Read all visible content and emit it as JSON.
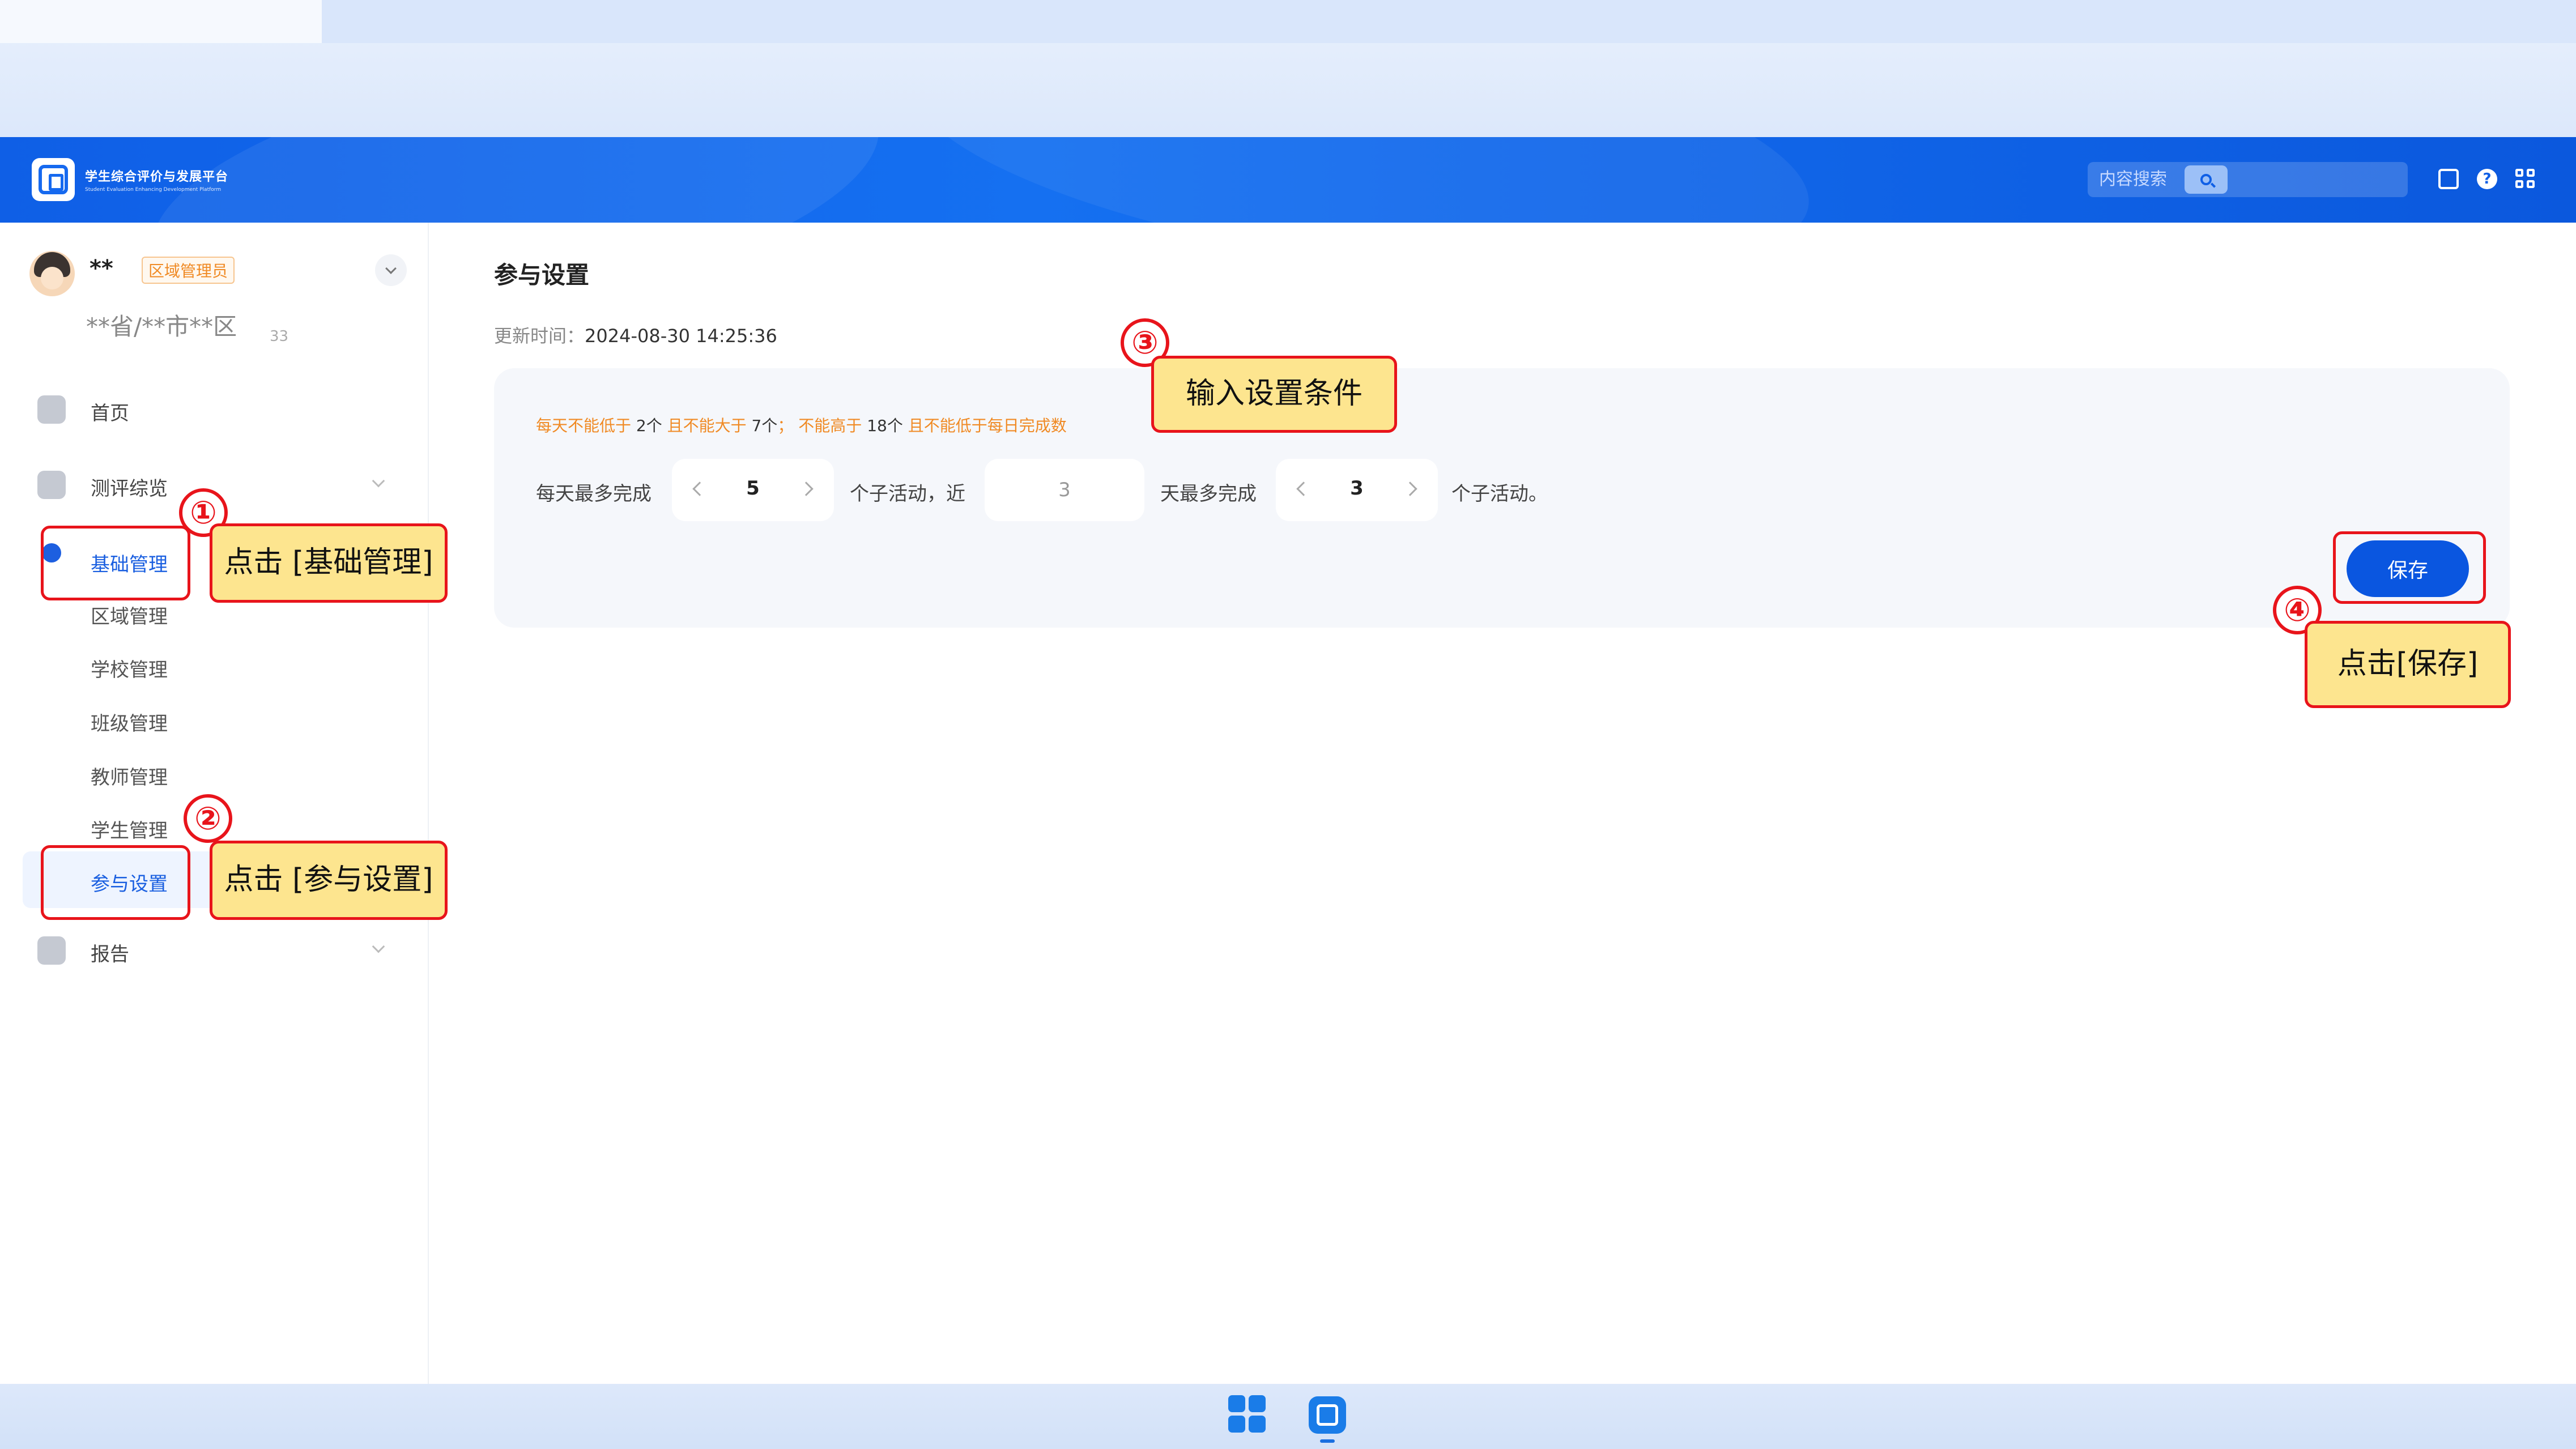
{
  "header": {
    "brand_cn": "学生综合评价与发展平台",
    "brand_en": "Student Evaluation Enhancing Development Platform",
    "search_placeholder": "内容搜索"
  },
  "user": {
    "name": "**",
    "role": "区域管理员",
    "region": "**省/**市**区",
    "version": "33"
  },
  "sidebar": {
    "items": [
      {
        "label": "首页"
      },
      {
        "label": "测评综览"
      },
      {
        "label": "基础管理"
      },
      {
        "label": "报告"
      }
    ],
    "sub_items": [
      {
        "label": "区域管理"
      },
      {
        "label": "学校管理"
      },
      {
        "label": "班级管理"
      },
      {
        "label": "教师管理"
      },
      {
        "label": "学生管理"
      },
      {
        "label": "参与设置"
      }
    ]
  },
  "main": {
    "title": "参与设置",
    "updated_label": "更新时间：",
    "updated_value": "2024-08-30  14:25:36",
    "rule": {
      "p1": "每天不能低于 ",
      "n1": "2个",
      "p2": " 且不能大于 ",
      "n2": "7个",
      "p3": "； 不能高于 ",
      "n3": "18个",
      "p4": " 且不能低于每日完成数"
    },
    "row": {
      "label1": "每天最多完成",
      "stepper1": "5",
      "label2": "个子活动，近",
      "days": "3",
      "label3": "天最多完成",
      "stepper2": "3",
      "label4": "个子活动。"
    },
    "save_label": "保存"
  },
  "annotations": [
    {
      "num": "①",
      "text": "点击 [基础管理]"
    },
    {
      "num": "②",
      "text": "点击 [参与设置]"
    },
    {
      "num": "③",
      "text": "输入设置条件"
    },
    {
      "num": "④",
      "text": "点击[保存]"
    }
  ],
  "colors": {
    "brand_blue": "#0f5fe6",
    "accent_orange": "#f08a24",
    "annotation_red": "#e8141b",
    "annotation_fill": "#fde58f"
  }
}
